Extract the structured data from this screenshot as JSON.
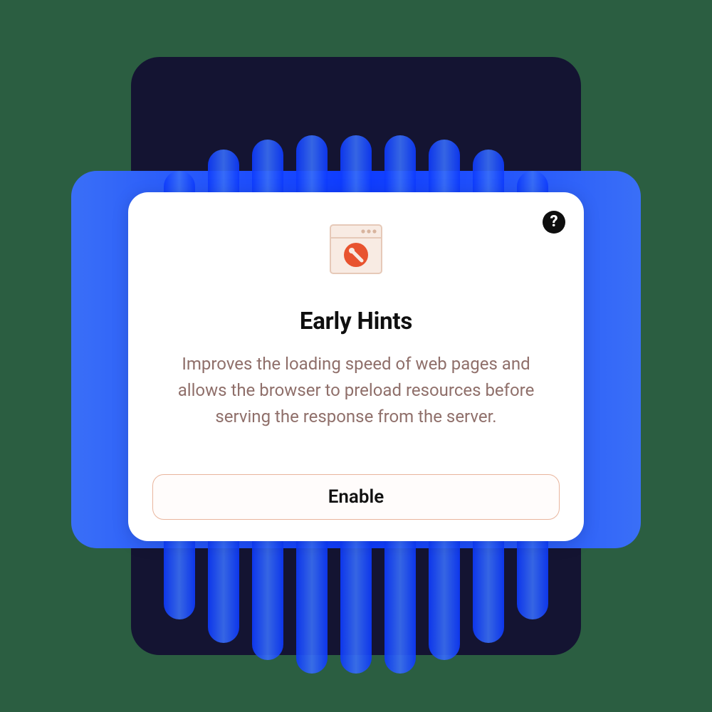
{
  "card": {
    "title": "Early Hints",
    "description": "Improves the loading speed of web pages and allows the browser to preload resources before serving the response from the server.",
    "button_label": "Enable",
    "help_glyph": "?"
  }
}
